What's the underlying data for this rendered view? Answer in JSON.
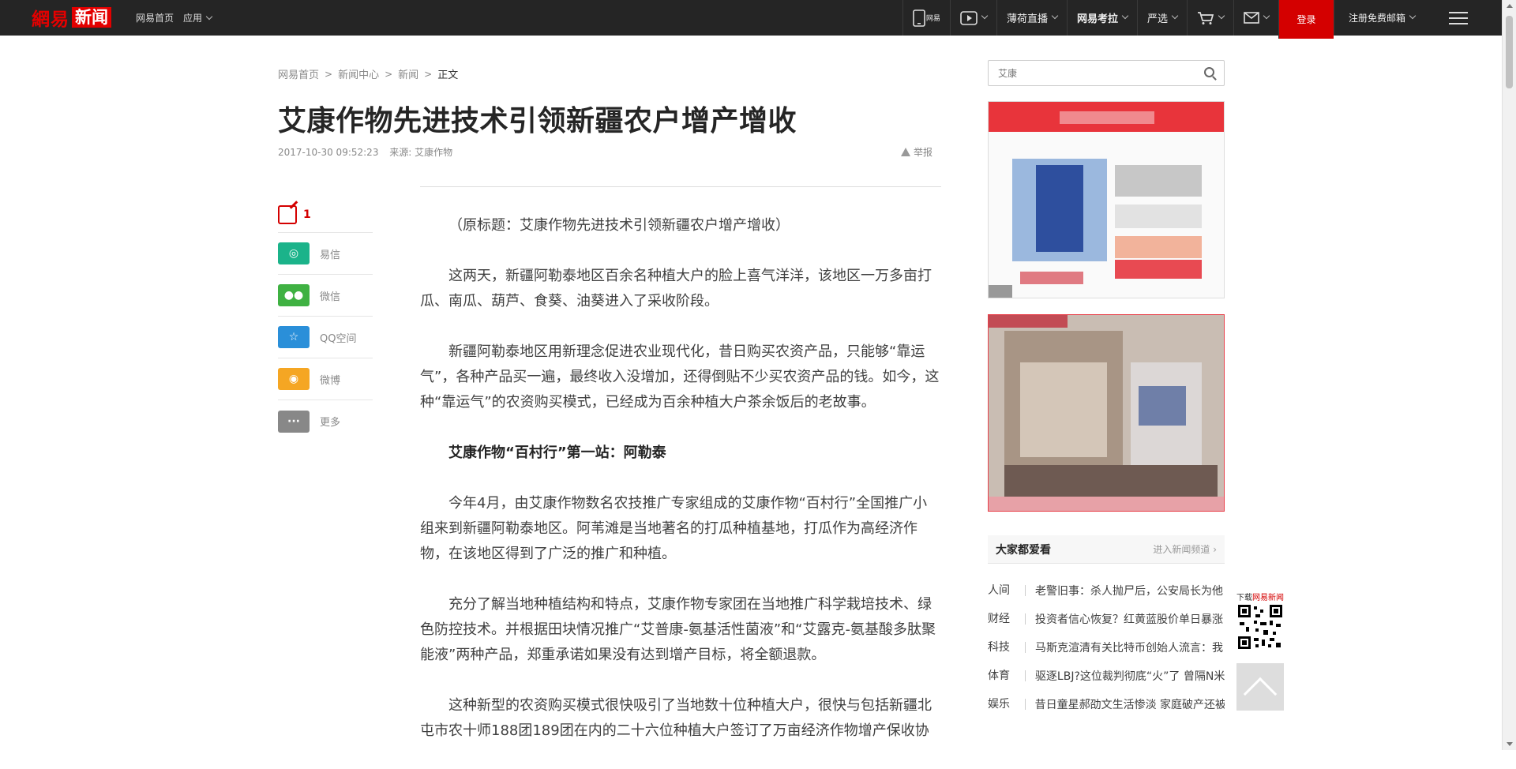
{
  "header": {
    "logo_main": "網易",
    "logo_sub": "新闻",
    "nav": [
      "网易首页",
      "应用"
    ],
    "right_items": [
      {
        "label": "网易",
        "icon": "phone-icon"
      },
      {
        "label": "",
        "icon": "play-icon"
      },
      {
        "label": "薄荷直播"
      },
      {
        "label": "网易考拉"
      },
      {
        "label": "严选"
      },
      {
        "label": "",
        "icon": "cart-icon"
      },
      {
        "label": "",
        "icon": "mail-icon"
      }
    ],
    "login_label": "登录",
    "mail_signup": "注册免费邮箱"
  },
  "breadcrumb": [
    "网易首页",
    "新闻中心",
    "新闻",
    "正文"
  ],
  "article": {
    "title": "艾康作物先进技术引领新疆农户增产增收",
    "date": "2017-10-30 09:52:23",
    "source": "来源: 艾康作物",
    "report": "举报",
    "paragraphs": [
      "（原标题：艾康作物先进技术引领新疆农户增产增收）",
      "这两天，新疆阿勒泰地区百余名种植大户的脸上喜气洋洋，该地区一万多亩打瓜、南瓜、葫芦、食葵、油葵进入了采收阶段。",
      "新疆阿勒泰地区用新理念促进农业现代化，昔日购买农资产品，只能够“靠运气”，各种产品买一遍，最终收入没增加，还得倒贴不少买农资产品的钱。如今，这种“靠运气”的农资购买模式，已经成为百余种植大户茶余饭后的老故事。",
      "艾康作物“百村行”第一站：阿勒泰",
      "今年4月，由艾康作物数名农技推广专家组成的艾康作物“百村行”全国推广小组来到新疆阿勒泰地区。阿苇滩是当地著名的打瓜种植基地，打瓜作为高经济作物，在该地区得到了广泛的推广和种植。",
      "充分了解当地种植结构和特点，艾康作物专家团在当地推广科学栽培技术、绿色防控技术。并根据田块情况推广“艾普康-氨基活性菌液”和“艾露克-氨基酸多肽聚能液”两种产品，郑重承诺如果没有达到增产目标，将全额退款。",
      "这种新型的农资购买模式很快吸引了当地数十位种植大户，很快与包括新疆北屯市农十师188团189团在内的二十六位种植大户签订了万亩经济作物增产保收协"
    ]
  },
  "share": {
    "comment_count": "1",
    "items": [
      {
        "label": "易信",
        "color": "#1bb38a",
        "icon": "yixin-icon"
      },
      {
        "label": "微信",
        "color": "#3fb142",
        "icon": "wechat-icon"
      },
      {
        "label": "QQ空间",
        "color": "#2a8fd9",
        "icon": "qzone-icon"
      },
      {
        "label": "微博",
        "color": "#f5a623",
        "icon": "weibo-icon"
      },
      {
        "label": "更多",
        "color": "#888888",
        "icon": "more-icon"
      }
    ]
  },
  "sidebar": {
    "search_placeholder": "艾康",
    "hot_title": "大家都爱看",
    "hot_more": "进入新闻频道",
    "hot_items": [
      {
        "cat": "人间",
        "text": "老警旧事：杀人抛尸后，公安局长为他"
      },
      {
        "cat": "财经",
        "text": "投资者信心恢复？红黄蓝股价单日暴涨"
      },
      {
        "cat": "科技",
        "text": "马斯克渲清有关比特币创始人流言：我"
      },
      {
        "cat": "体育",
        "text": "驱逐LBJ?这位裁判彻底“火”了 曾隔N米"
      },
      {
        "cat": "娱乐",
        "text": "昔日童星郝劭文生活惨淡 家庭破产还被"
      }
    ],
    "qr_label_prefix": "下载",
    "qr_label_brand": "网易新闻"
  },
  "colors": {
    "brand_red": "#d40000",
    "topbar": "#252525"
  }
}
